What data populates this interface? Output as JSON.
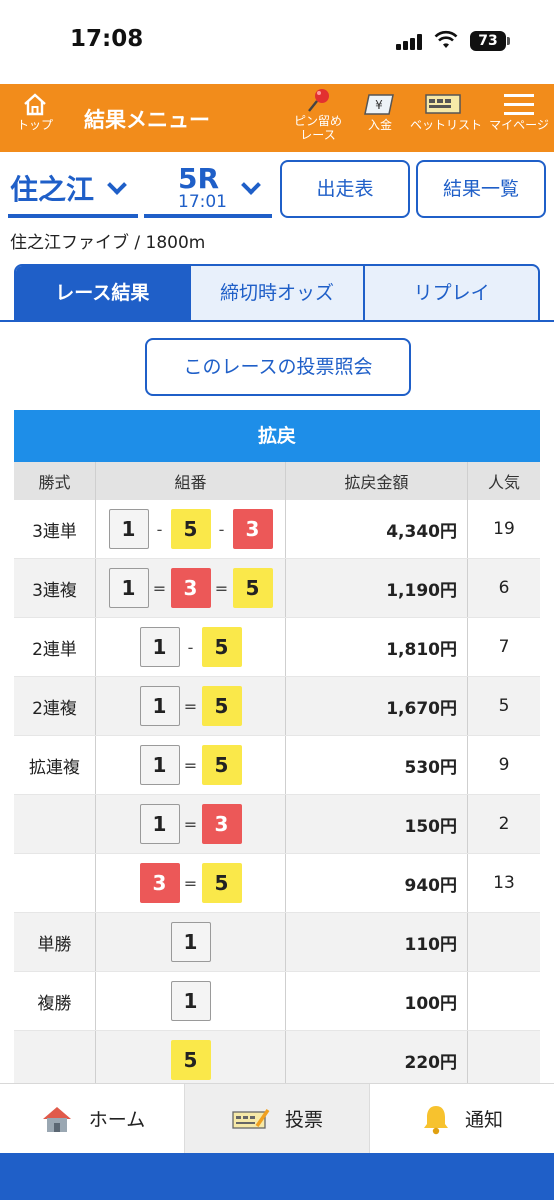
{
  "status": {
    "time": "17:08",
    "battery": "73"
  },
  "header": {
    "top_label": "トップ",
    "title": "結果メニュー",
    "pin_label_1": "ピン留め",
    "pin_label_2": "レース",
    "deposit_label": "入金",
    "betlist_label": "ベットリスト",
    "mypage_label": "マイページ"
  },
  "race_info": {
    "venue": "住之江",
    "race_number": "5R",
    "race_time": "17:01",
    "entries_button": "出走表",
    "results_button": "結果一覧",
    "subtitle": "住之江ファイブ / 1800m"
  },
  "tabs": [
    "レース結果",
    "締切時オッズ",
    "リプレイ"
  ],
  "vote_button": "このレースの投票照会",
  "payout": {
    "title": "拡戻",
    "columns": [
      "勝式",
      "組番",
      "拡戻金額",
      "人気"
    ],
    "rows": [
      {
        "type": "3連単",
        "combo": [
          "1",
          "5",
          "3"
        ],
        "sep": "-",
        "amount": "4,340円",
        "pop": "19"
      },
      {
        "type": "3連複",
        "combo": [
          "1",
          "3",
          "5"
        ],
        "sep": "=",
        "amount": "1,190円",
        "pop": "6"
      },
      {
        "type": "2連単",
        "combo": [
          "1",
          "5"
        ],
        "sep": "-",
        "amount": "1,810円",
        "pop": "7"
      },
      {
        "type": "2連複",
        "combo": [
          "1",
          "5"
        ],
        "sep": "=",
        "amount": "1,670円",
        "pop": "5"
      },
      {
        "type": "拡連複",
        "combo": [
          "1",
          "5"
        ],
        "sep": "=",
        "amount": "530円",
        "pop": "9"
      },
      {
        "type": "",
        "combo": [
          "1",
          "3"
        ],
        "sep": "=",
        "amount": "150円",
        "pop": "2"
      },
      {
        "type": "",
        "combo": [
          "3",
          "5"
        ],
        "sep": "=",
        "amount": "940円",
        "pop": "13"
      },
      {
        "type": "単勝",
        "combo": [
          "1"
        ],
        "sep": "",
        "amount": "110円",
        "pop": ""
      },
      {
        "type": "複勝",
        "combo": [
          "1"
        ],
        "sep": "",
        "amount": "100円",
        "pop": ""
      },
      {
        "type": "",
        "combo": [
          "5"
        ],
        "sep": "",
        "amount": "220円",
        "pop": ""
      }
    ]
  },
  "bottom_nav": [
    "ホーム",
    "投票",
    "通知"
  ],
  "colors": {
    "brand_orange": "#f28c1b",
    "brand_blue": "#1f5fc8",
    "table_blue": "#1e8ee8",
    "box_red": "#ec5858",
    "box_yellow": "#fae84a"
  }
}
